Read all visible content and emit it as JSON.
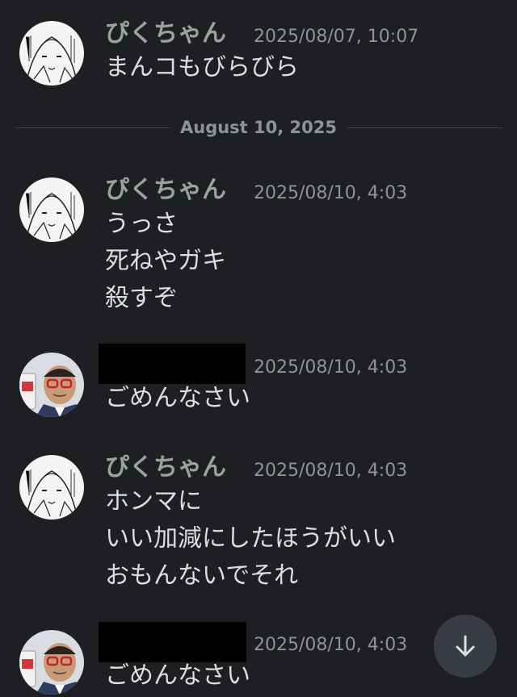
{
  "messages": [
    {
      "author": "ぴくちゃん",
      "time": "2025/08/07, 10:07",
      "lines": [
        "まんコもびらびら"
      ]
    },
    {
      "author": "ぴくちゃん",
      "time": "2025/08/10, 4:03",
      "lines": [
        "うっさ",
        "死ねやガキ",
        "殺すぞ"
      ]
    },
    {
      "author": "",
      "time": "2025/08/10, 4:03",
      "lines": [
        "ごめんなさい"
      ]
    },
    {
      "author": "ぴくちゃん",
      "time": "2025/08/10, 4:03",
      "lines": [
        "ホンマに",
        "いい加減にしたほうがいい",
        "おもんないでそれ"
      ]
    },
    {
      "author": "",
      "time": "2025/08/10, 4:03",
      "lines": [
        "ごめんなさい"
      ]
    }
  ],
  "date_divider": "August 10, 2025",
  "icons": {
    "jump": "arrow-down-icon",
    "avatar_a": "manga-avatar-image",
    "avatar_b": "man-with-glasses-avatar-image"
  },
  "colors": {
    "background": "#1e1f22",
    "author": "#9aa39a",
    "text": "#dbdee1",
    "muted": "#8d929b"
  }
}
